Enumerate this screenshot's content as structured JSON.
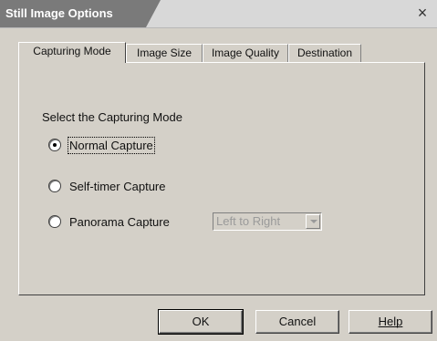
{
  "window": {
    "title": "Still Image Options",
    "close_glyph": "×"
  },
  "tabs": [
    {
      "label": "Capturing Mode",
      "active": true
    },
    {
      "label": "Image Size",
      "active": false
    },
    {
      "label": "Image Quality",
      "active": false
    },
    {
      "label": "Destination",
      "active": false
    }
  ],
  "capture": {
    "section_label": "Select the Capturing Mode",
    "options": [
      {
        "label": "Normal Capture",
        "checked": true
      },
      {
        "label": "Self-timer Capture",
        "checked": false
      },
      {
        "label": "Panorama Capture",
        "checked": false
      }
    ],
    "panorama_direction": {
      "value": "Left to Right",
      "enabled": false
    }
  },
  "buttons": {
    "ok": "OK",
    "cancel": "Cancel",
    "help": "Help"
  },
  "icons": {
    "close": "close-icon",
    "dropdown": "chevron-down-icon"
  },
  "colors": {
    "dialog_bg": "#d4d0c8",
    "title_tab_bg": "#7a7a7a",
    "title_text": "#ffffff",
    "disabled_text": "#9a9a9a"
  }
}
